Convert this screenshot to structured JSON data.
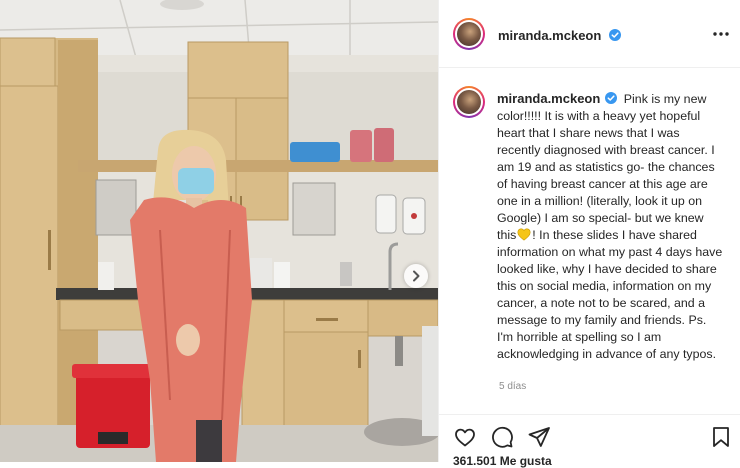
{
  "post": {
    "username": "miranda.mckeon",
    "caption_parts": [
      "Pink is my new color!!!!! It is with a heavy yet hopeful heart that I share news that I was recently diagnosed with breast cancer. I am 19 and as statistics go- the chances of having breast cancer at this age are one in a million! (literally, look it up on Google) I am so special- but we knew this",
      "! In these slides I have shared information on what my past 4 days have looked like, why I have decided to share this on social media, information on my cancer, a note not to be scared, and a message to my family and friends. Ps. I'm horrible at spelling so I am acknowledging in advance of any typos."
    ],
    "time_ago": "5 días",
    "likes": "361.501 Me gusta"
  },
  "icons": {
    "verified": "verified-badge-icon",
    "more": "more-options-icon",
    "heart_emoji": "yellow-heart-emoji-icon",
    "like": "heart-icon",
    "comment": "comment-icon",
    "share": "paper-plane-icon",
    "save": "bookmark-icon",
    "next": "chevron-right-icon"
  },
  "colors": {
    "verified_blue": "#3897f0",
    "story_ring": "#dd2a7b",
    "heart_emoji": "#f5c518",
    "gown": "#e37a69",
    "trash_can": "#d6202b"
  }
}
